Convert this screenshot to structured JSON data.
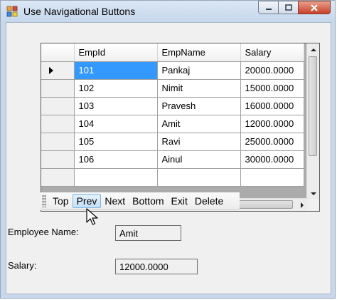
{
  "window": {
    "title": "Use Navigational Buttons"
  },
  "colors": {
    "selected_cell": "#3399ff",
    "titlebar": "#c8d8ec",
    "close_button": "#c8412a"
  },
  "grid": {
    "columns": [
      "EmpId",
      "EmpName",
      "Salary"
    ],
    "rows": [
      {
        "id": "101",
        "name": "Pankaj",
        "salary": "20000.0000",
        "current": true
      },
      {
        "id": "102",
        "name": "Nimit",
        "salary": "15000.0000",
        "current": false
      },
      {
        "id": "103",
        "name": "Pravesh",
        "salary": "16000.0000",
        "current": false
      },
      {
        "id": "104",
        "name": "Amit",
        "salary": "12000.0000",
        "current": false
      },
      {
        "id": "105",
        "name": "Ravi",
        "salary": "25000.0000",
        "current": false
      },
      {
        "id": "106",
        "name": "Ainul",
        "salary": "30000.0000",
        "current": false
      }
    ]
  },
  "toolbar": {
    "buttons": [
      "Top",
      "Prev",
      "Next",
      "Bottom",
      "Exit",
      "Delete"
    ],
    "hovered": "Prev"
  },
  "form": {
    "employee_name_label": "Employee Name:",
    "employee_name_value": "Amit",
    "salary_label": "Salary:",
    "salary_value": "12000.0000"
  }
}
